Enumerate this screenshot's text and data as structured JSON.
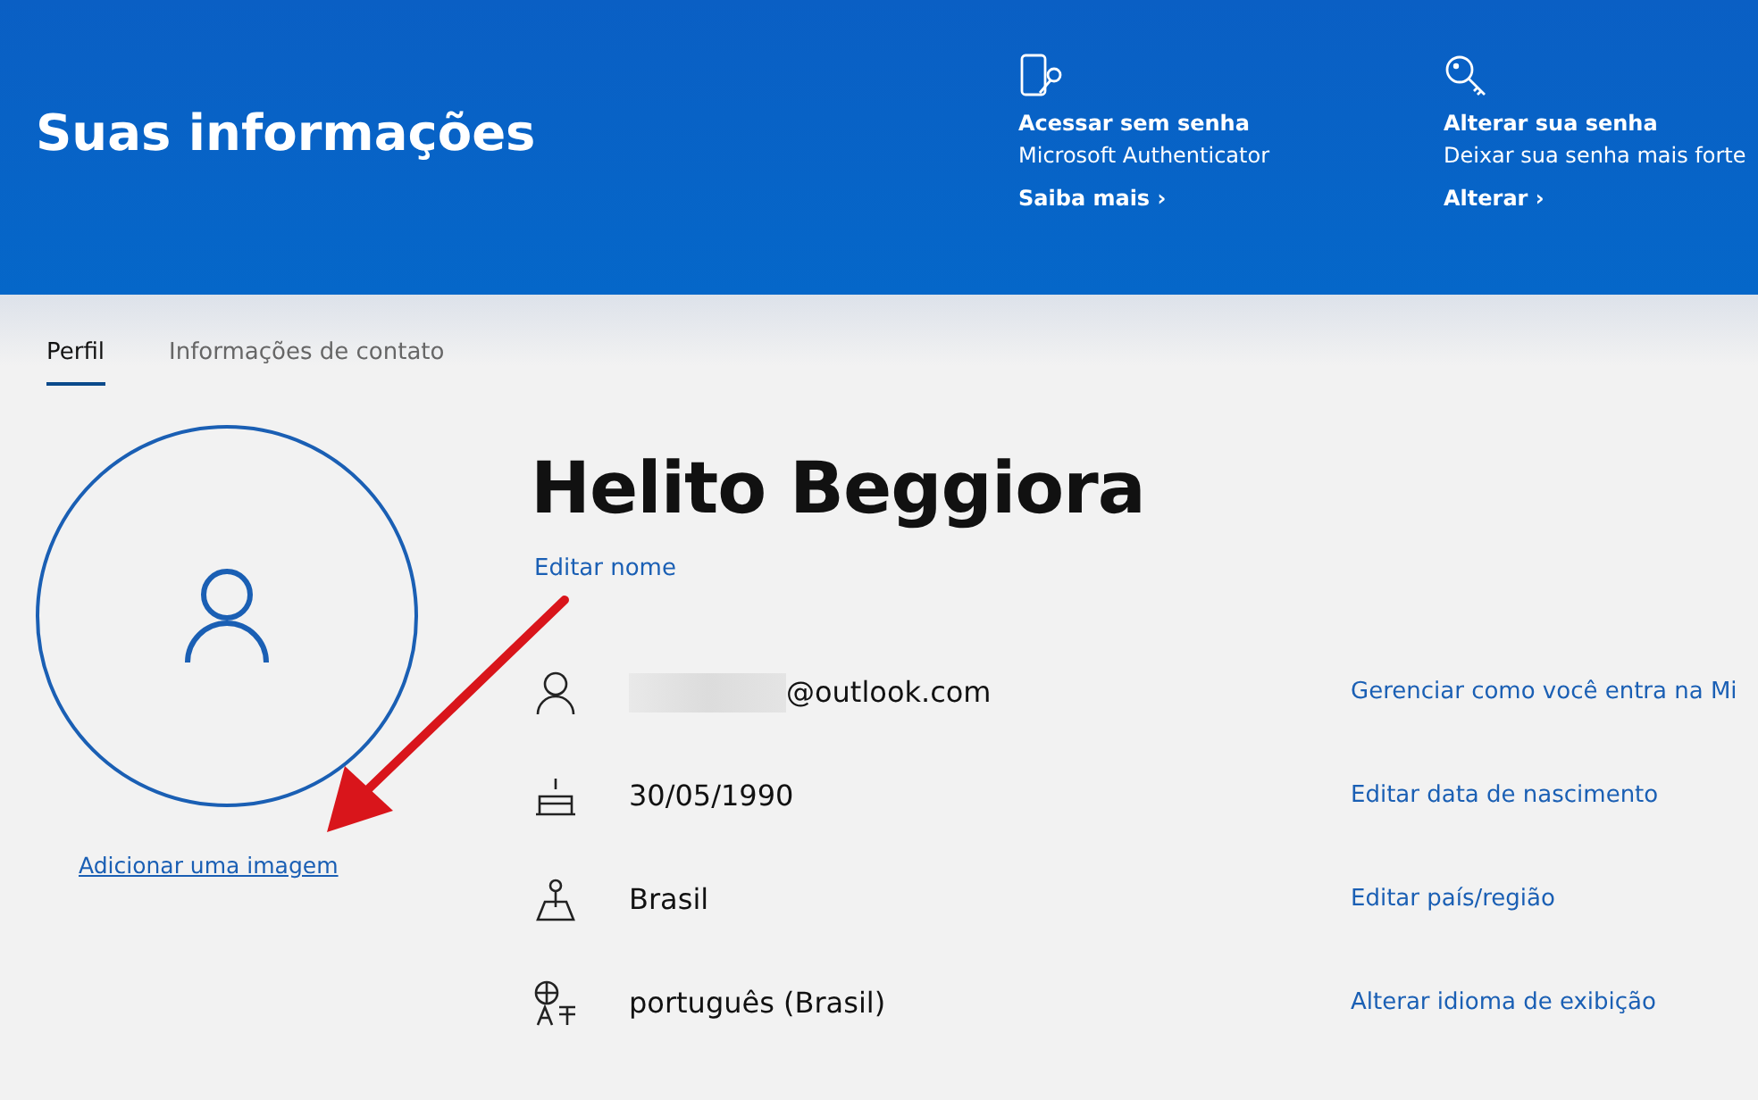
{
  "header": {
    "title": "Suas informações",
    "cards": [
      {
        "kind": "phone-key",
        "title": "Acessar sem senha",
        "subtitle": "Microsoft Authenticator",
        "link": "Saiba mais",
        "chevron": "›"
      },
      {
        "kind": "key",
        "title": "Alterar sua senha",
        "subtitle": "Deixar sua senha mais forte",
        "link": "Alterar",
        "chevron": "›"
      }
    ]
  },
  "tabs": [
    {
      "label": "Perfil",
      "selected": true
    },
    {
      "label": "Informações de contato",
      "selected": false
    }
  ],
  "avatar": {
    "link": "Adicionar uma imagem"
  },
  "profile": {
    "name": "Helito Beggiora",
    "edit_link": "Editar nome",
    "rows": [
      {
        "kind": "account",
        "redacted": true,
        "value": "@outlook.com",
        "link": "Gerenciar como você entra na Mi"
      },
      {
        "kind": "birthday",
        "redacted": false,
        "value": "30/05/1990",
        "link": "Editar data de nascimento"
      },
      {
        "kind": "region",
        "redacted": false,
        "value": "Brasil",
        "link": "Editar país/região"
      },
      {
        "kind": "language",
        "redacted": false,
        "value": "português (Brasil)",
        "link": "Alterar idioma de exibição"
      }
    ]
  },
  "annotation": {
    "kind": "arrow"
  }
}
